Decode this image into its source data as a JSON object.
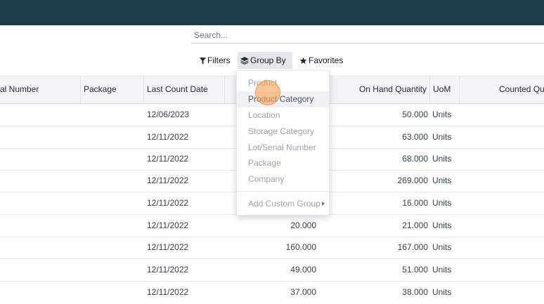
{
  "search": {
    "placeholder": "Search..."
  },
  "controls": {
    "filters": "Filters",
    "group_by": "Group By",
    "favorites": "Favorites"
  },
  "table": {
    "columns": [
      "al Number",
      "Package",
      "Last Count Date",
      "",
      "On Hand Quantity",
      "UoM",
      "Counted Qu"
    ],
    "rows": [
      {
        "last_count_date": "12/06/2023",
        "qty_hidden": "",
        "on_hand": "50.000",
        "uom": "Units"
      },
      {
        "last_count_date": "12/11/2022",
        "qty_hidden": "",
        "on_hand": "63.000",
        "uom": "Units"
      },
      {
        "last_count_date": "12/11/2022",
        "qty_hidden": "",
        "on_hand": "68.000",
        "uom": "Units"
      },
      {
        "last_count_date": "12/11/2022",
        "qty_hidden": "",
        "on_hand": "269.000",
        "uom": "Units"
      },
      {
        "last_count_date": "12/11/2022",
        "qty_hidden": "",
        "on_hand": "16.000",
        "uom": "Units"
      },
      {
        "last_count_date": "12/11/2022",
        "qty_hidden": "20.000",
        "on_hand": "21.000",
        "uom": "Units"
      },
      {
        "last_count_date": "12/11/2022",
        "qty_hidden": "160.000",
        "on_hand": "167.000",
        "uom": "Units"
      },
      {
        "last_count_date": "12/11/2022",
        "qty_hidden": "49.000",
        "on_hand": "51.000",
        "uom": "Units"
      },
      {
        "last_count_date": "12/11/2022",
        "qty_hidden": "37.000",
        "on_hand": "38.000",
        "uom": "Units"
      }
    ]
  },
  "group_by_menu": {
    "items": [
      "Product",
      "Product Category",
      "Location",
      "Storage Category",
      "Lot/Serial Number",
      "Package",
      "Company"
    ],
    "add_custom": "Add Custom Group",
    "active_index": 1
  },
  "colors": {
    "topbar": "#1e3f4a",
    "header_bg": "#f3f4f6",
    "cursor": "#f9a155"
  },
  "icons": {
    "filters": "funnel-icon",
    "group_by": "layers-icon",
    "favorites": "star-icon",
    "submenu": "caret-right-icon"
  }
}
